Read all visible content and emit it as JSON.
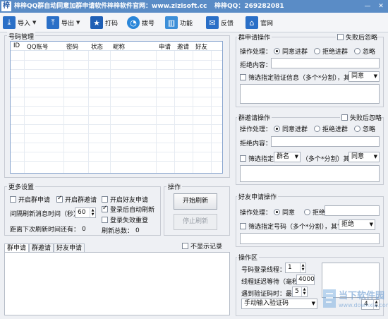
{
  "window": {
    "app_title": "梓梓QQ群自动同意加群申请软件",
    "site_label": "梓梓软件官网：www.zizisoft.cc",
    "qq_label": "梓梓QQ：269282081",
    "minimize": "—",
    "close": "✕"
  },
  "toolbar": {
    "import": "导入",
    "export": "导出",
    "code": "打码",
    "dial": "拨号",
    "function": "功能",
    "feedback": "反馈",
    "website": "官网"
  },
  "account_mgmt": {
    "title": "号码管理",
    "columns": [
      "ID",
      "QQ账号",
      "密码",
      "状态",
      "昵称",
      "申请",
      "邀请",
      "好友"
    ]
  },
  "more_settings": {
    "title": "更多设置",
    "auto_apply": "开启群申请",
    "auto_invite": "开启群邀请",
    "auto_friend": "开启好友申请",
    "interval_label": "间隔刷新消息时间（秒）：",
    "interval_value": "60",
    "login_auto_refresh": "登录后自动刷新",
    "login_fail_relogin": "登录失效重登",
    "next_refresh_label": "距离下次刷新时间还有：",
    "next_refresh_value": "0",
    "refresh_total_label": "刷新总数：",
    "refresh_total_value": "0"
  },
  "operation": {
    "title": "操作",
    "start": "开始刷新",
    "stop": "停止刷新"
  },
  "log": {
    "tabs": [
      "群申请",
      "群邀请",
      "好友申请"
    ],
    "hide_records": "不显示记录"
  },
  "group_apply": {
    "title": "群申请操作",
    "fail_ignore": "失败后忽略",
    "process_label": "操作处理：",
    "agree": "同意进群",
    "reject": "拒绝进群",
    "ignore": "忽略",
    "reject_reason_label": "拒绝内容：",
    "filter_label": "筛选指定验证信息（多个*分割），其它：",
    "filter_select": "同意"
  },
  "group_invite": {
    "title": "群邀请操作",
    "fail_ignore": "失败后忽略",
    "process_label": "操作处理：",
    "agree": "同意进群",
    "reject": "拒绝进群",
    "ignore": "忽略",
    "reject_reason_label": "拒绝内容：",
    "filter_label": "筛选指定",
    "filter_field": "群名",
    "filter_mid": "（多个*分割）其它：",
    "filter_select": "同意"
  },
  "friend_apply": {
    "title": "好友申请操作",
    "process_label": "操作处理：",
    "agree": "同意",
    "reject": "拒绝：",
    "filter_label": "筛选指定号码（多个*分割），其它：",
    "filter_select": "拒绝"
  },
  "operation_area": {
    "title": "操作区",
    "threads_label": "号码登录线程：",
    "threads_value": "1",
    "delay_label": "线程延迟等待（毫秒）：",
    "delay_value": "4000",
    "captcha_label": "遇到验证码时：最多",
    "captcha_value": "5",
    "captcha_mode": "手动输入验证码",
    "extra_value": "4"
  },
  "watermark": {
    "text1": "当下软件园",
    "text2": "www.downxia.com"
  },
  "colors": {
    "titlebar": "#5a8cc6",
    "accent": "#2a6fc7"
  }
}
